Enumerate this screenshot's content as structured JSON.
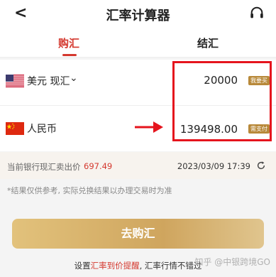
{
  "header": {
    "title": "汇率计算器",
    "back_glyph": "<"
  },
  "tabs": [
    {
      "label": "购汇",
      "active": true
    },
    {
      "label": "结汇",
      "active": false
    }
  ],
  "from": {
    "currency": "美元 现汇",
    "amount": "20000",
    "tag": "我要买"
  },
  "to": {
    "currency": "人民币",
    "amount": "139498.00",
    "tag": "需支付"
  },
  "rate": {
    "label": "当前银行现汇卖出价",
    "value": "697.49",
    "time": "2023/03/09 17:39"
  },
  "note": "*结果仅供参考, 实际兑换结果以办理交易时为准",
  "button": {
    "label": "去购汇"
  },
  "footer": {
    "prefix": "设置",
    "link": "汇率到价提醒",
    "suffix": ", 汇率行情不错过"
  },
  "watermark": "知乎 @中银跨境GO",
  "colors": {
    "accent": "#d4382e",
    "highlight": "#e5141d",
    "gold": "#cfa55e"
  }
}
